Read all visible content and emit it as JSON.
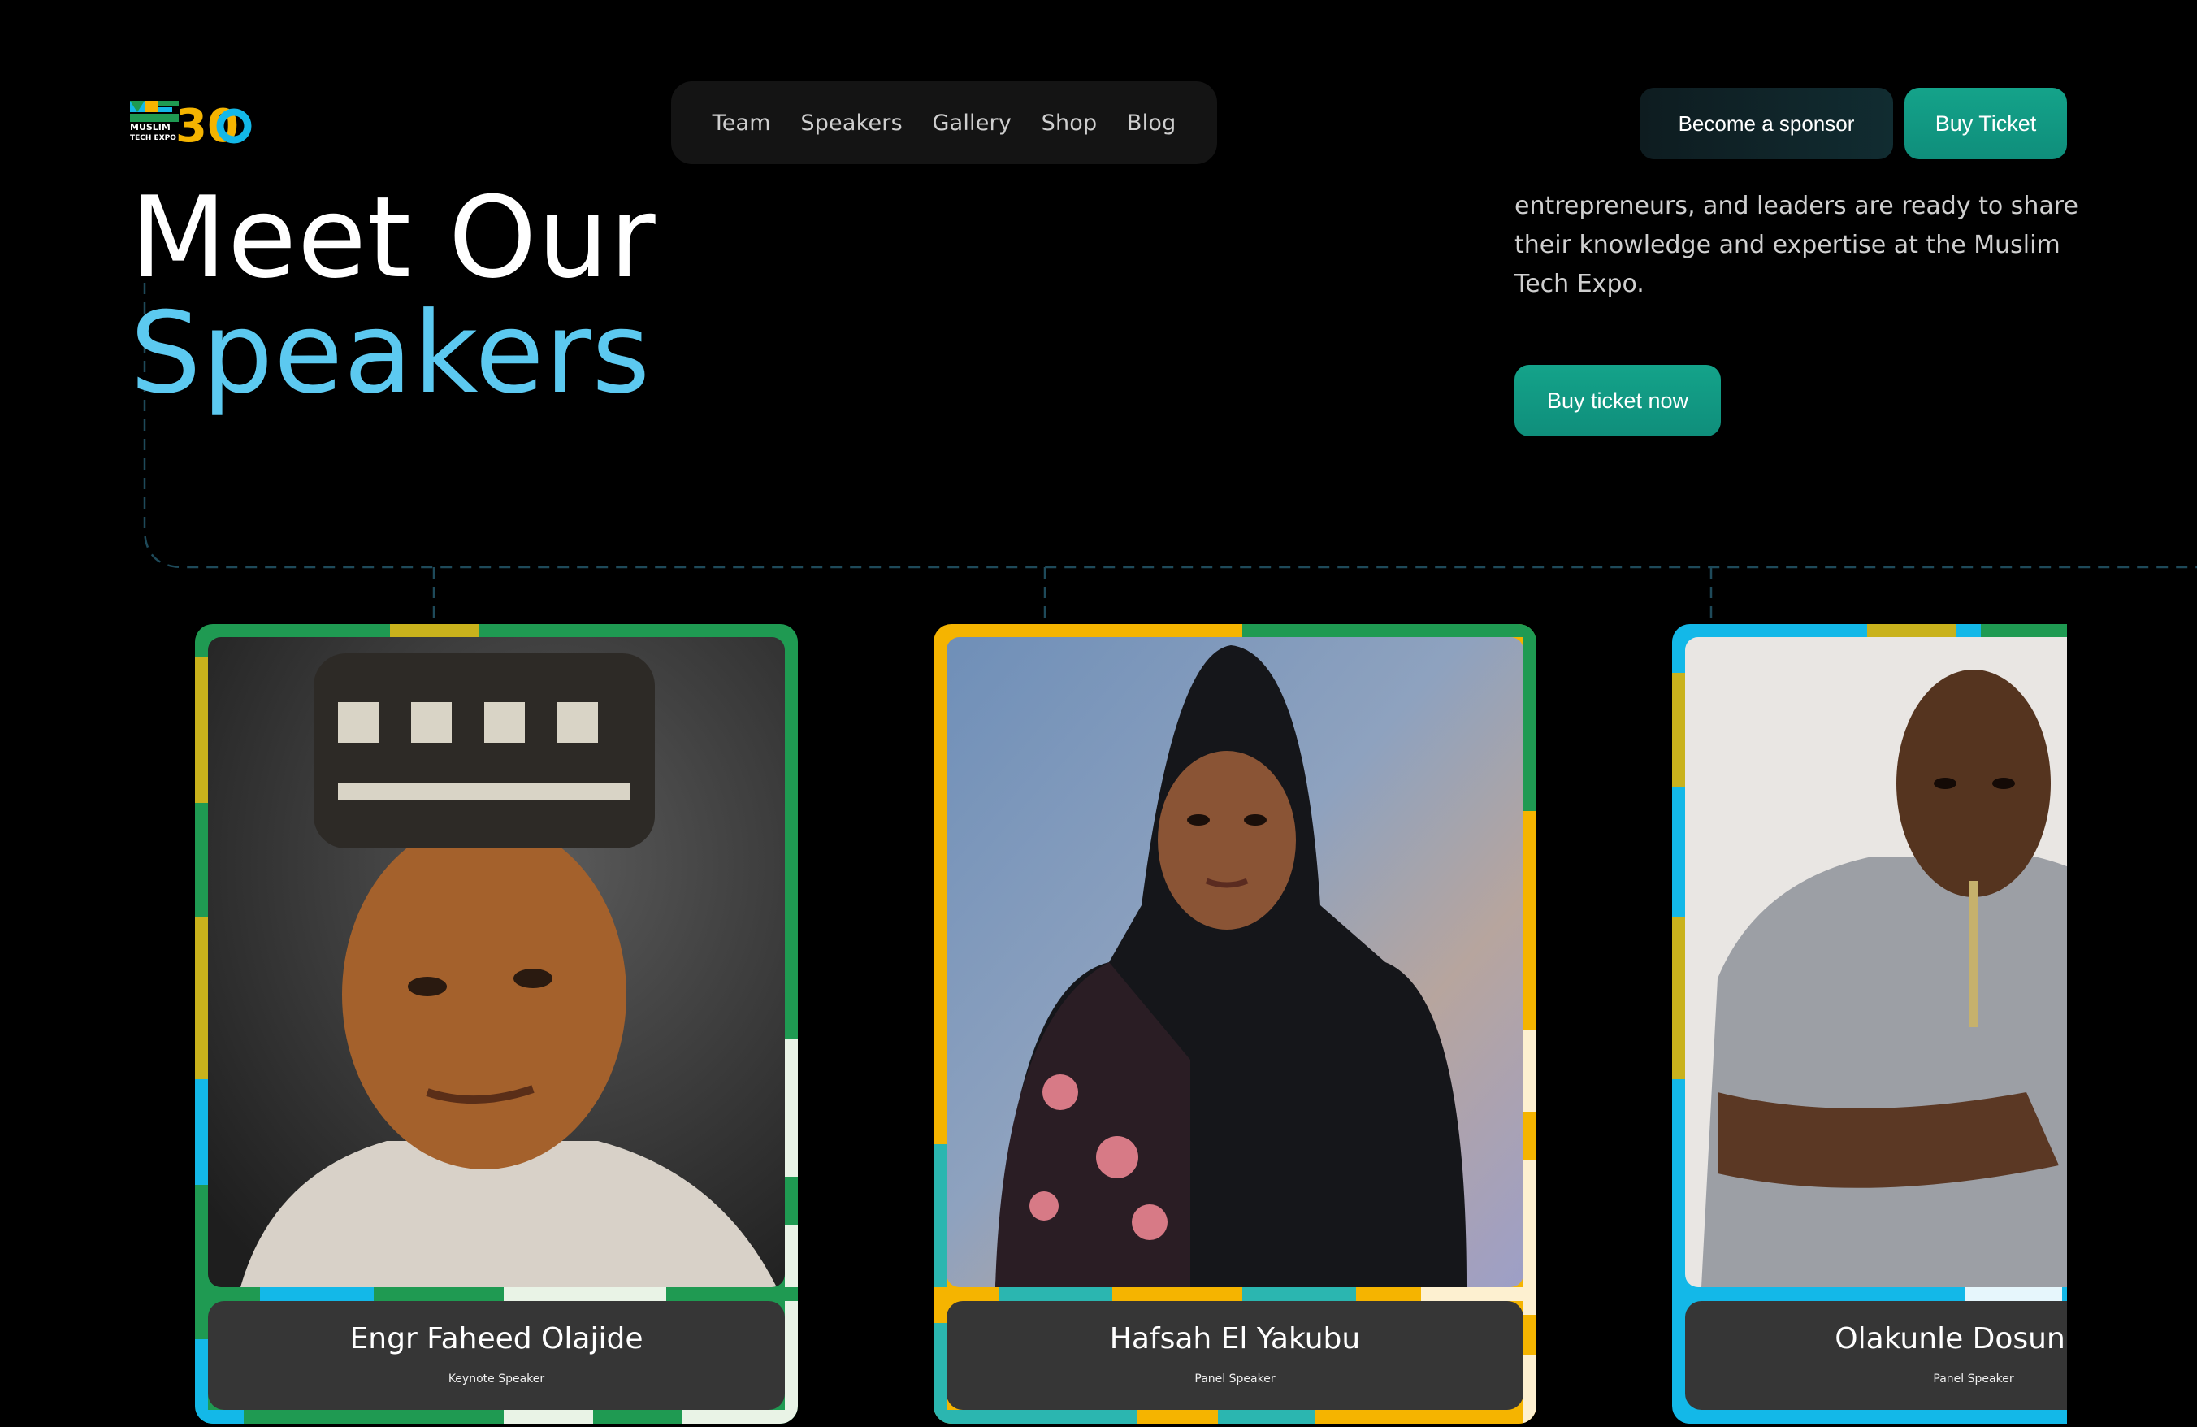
{
  "header": {
    "logo": {
      "mark": "ME",
      "number": "30",
      "caption_line1": "MUSLIM",
      "caption_line2": "TECH EXPO"
    },
    "nav": [
      "Team",
      "Speakers",
      "Gallery",
      "Shop",
      "Blog"
    ],
    "sponsor_label": "Become a sponsor",
    "buy_label": "Buy Ticket"
  },
  "hero": {
    "title_line1": "Meet Our",
    "title_line2": "Speakers",
    "description": "entrepreneurs, and leaders are ready to share their knowledge and expertise at the Muslim Tech Expo.",
    "cta_label": "Buy ticket now"
  },
  "speakers": [
    {
      "name": "Engr Faheed Olajide",
      "role": "Keynote Speaker"
    },
    {
      "name": "Hafsah El Yakubu",
      "role": "Panel Speaker"
    },
    {
      "name": "Olakunle Dosunmu",
      "role": "Panel Speaker"
    }
  ],
  "colors": {
    "background": "#000000",
    "accent_blue": "#5cc9f0",
    "accent_teal": "#14a38a",
    "frame_green": "#1f9a52",
    "frame_yellow": "#f5b400",
    "frame_cyan": "#13b8e8",
    "name_box": "#363636"
  }
}
